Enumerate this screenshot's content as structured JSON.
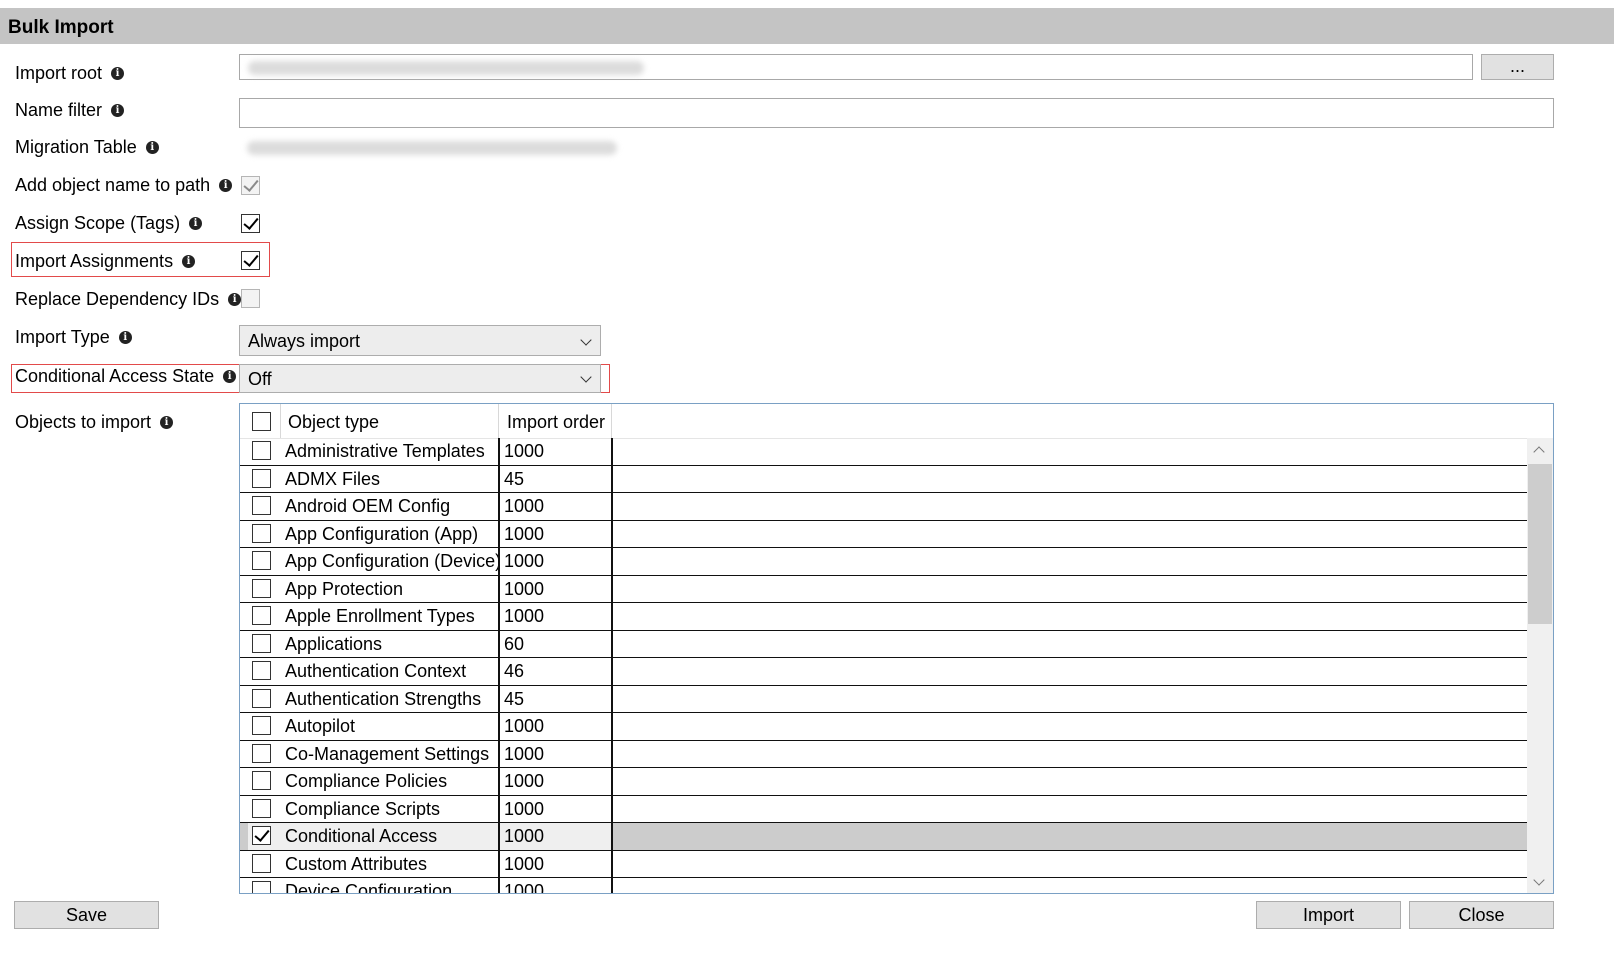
{
  "window": {
    "title": "Bulk Import"
  },
  "form": {
    "import_root": {
      "label": "Import root",
      "value": "",
      "browse_label": "..."
    },
    "name_filter": {
      "label": "Name filter",
      "value": ""
    },
    "migration_table": {
      "label": "Migration Table",
      "value": ""
    },
    "add_object_name": {
      "label": "Add object name to path",
      "checked": true,
      "disabled": true
    },
    "assign_scope": {
      "label": "Assign Scope (Tags)",
      "checked": true
    },
    "import_assignments": {
      "label": "Import Assignments",
      "checked": true
    },
    "replace_dependency": {
      "label": "Replace Dependency IDs",
      "checked": false,
      "disabled": true
    },
    "import_type": {
      "label": "Import Type",
      "value": "Always import"
    },
    "ca_state": {
      "label": "Conditional Access State",
      "value": "Off"
    },
    "objects": {
      "label": "Objects to import"
    }
  },
  "grid": {
    "col_type": "Object type",
    "col_order": "Import order",
    "rows": [
      {
        "type": "Administrative Templates",
        "order": "1000",
        "checked": false
      },
      {
        "type": "ADMX Files",
        "order": "45",
        "checked": false
      },
      {
        "type": "Android OEM Config",
        "order": "1000",
        "checked": false
      },
      {
        "type": "App Configuration (App)",
        "order": "1000",
        "checked": false
      },
      {
        "type": "App Configuration (Device)",
        "order": "1000",
        "checked": false
      },
      {
        "type": "App Protection",
        "order": "1000",
        "checked": false
      },
      {
        "type": "Apple Enrollment Types",
        "order": "1000",
        "checked": false
      },
      {
        "type": "Applications",
        "order": "60",
        "checked": false
      },
      {
        "type": "Authentication Context",
        "order": "46",
        "checked": false
      },
      {
        "type": "Authentication Strengths",
        "order": "45",
        "checked": false
      },
      {
        "type": "Autopilot",
        "order": "1000",
        "checked": false
      },
      {
        "type": "Co-Management Settings",
        "order": "1000",
        "checked": false
      },
      {
        "type": "Compliance Policies",
        "order": "1000",
        "checked": false
      },
      {
        "type": "Compliance Scripts",
        "order": "1000",
        "checked": false
      },
      {
        "type": "Conditional Access",
        "order": "1000",
        "checked": true,
        "selected": true
      },
      {
        "type": "Custom Attributes",
        "order": "1000",
        "checked": false
      },
      {
        "type": "Device Configuration",
        "order": "1000",
        "checked": false
      }
    ]
  },
  "footer": {
    "save_label": "Save",
    "import_label": "Import",
    "close_label": "Close"
  }
}
